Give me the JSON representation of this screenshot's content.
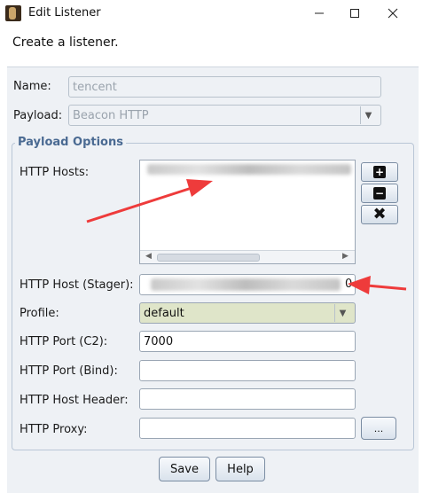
{
  "window": {
    "title": "Edit Listener",
    "controls": [
      "minimize-icon",
      "maximize-icon",
      "close-icon"
    ]
  },
  "header": {
    "text": "Create a listener."
  },
  "fields": {
    "name": {
      "label": "Name:",
      "value": "tencent"
    },
    "payload": {
      "label": "Payload:",
      "value": "Beacon HTTP"
    }
  },
  "options": {
    "title": "Payload Options",
    "hosts": {
      "label": "HTTP Hosts:",
      "entries": []
    },
    "host_stager": {
      "label": "HTTP Host (Stager):",
      "value_tail": "0"
    },
    "profile": {
      "label": "Profile:",
      "value": "default"
    },
    "port_c2": {
      "label": "HTTP Port (C2):",
      "value": "7000"
    },
    "port_bind": {
      "label": "HTTP Port (Bind):",
      "value": ""
    },
    "host_header": {
      "label": "HTTP Host Header:",
      "value": ""
    },
    "proxy": {
      "label": "HTTP Proxy:",
      "value": "",
      "button": "..."
    }
  },
  "buttons": {
    "save": "Save",
    "help": "Help"
  },
  "colors": {
    "annotation_arrow": "#ee3b3b",
    "group_title": "#4a6a92",
    "background": "#eef1f5"
  }
}
